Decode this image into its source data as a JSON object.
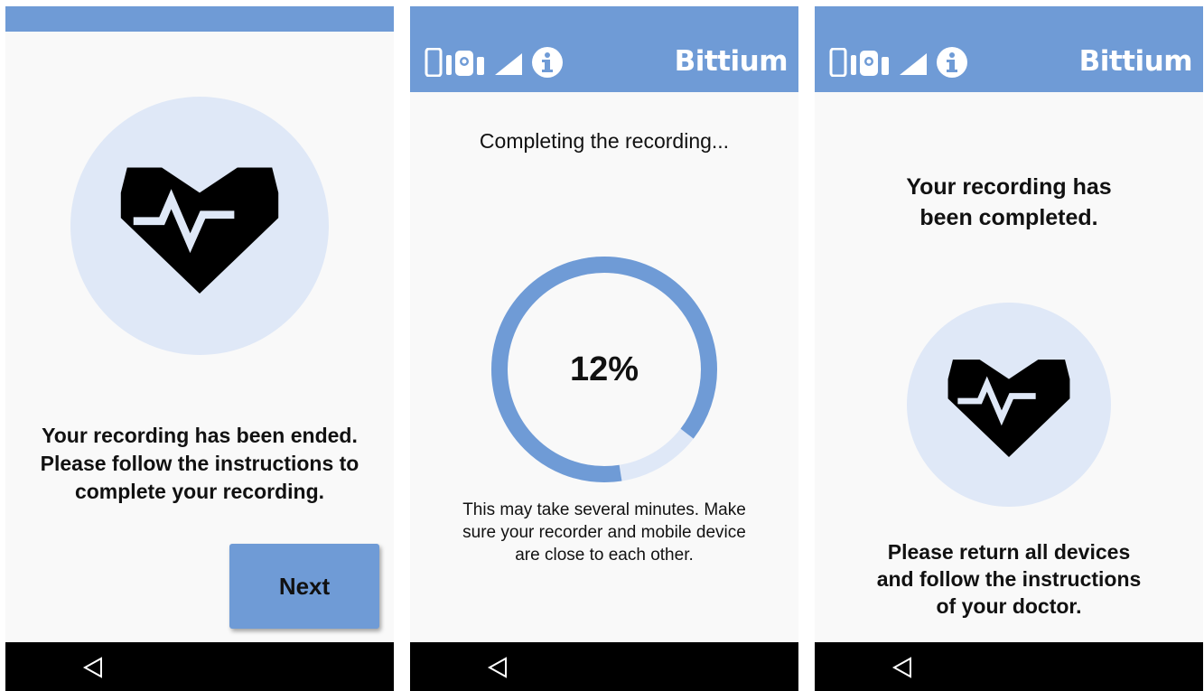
{
  "screens": [
    {
      "message": "Your recording has been ended.\nPlease follow the instructions to\ncomplete your recording.",
      "next_label": "Next"
    },
    {
      "brand": "Bittium",
      "heading": "Completing the recording...",
      "progress_text": "12%",
      "progress_fraction": 0.12,
      "info": "This may take several minutes. Make sure your recorder and mobile device are close to each other."
    },
    {
      "brand": "Bittium",
      "title": "Your recording has\nbeen completed.",
      "message": "Please return all devices\nand follow the instructions\nof your doctor."
    }
  ],
  "icons": {
    "status": [
      "phone-icon",
      "recorder-icon",
      "signal-icon",
      "info-icon"
    ],
    "heart": "heart-ecg-icon",
    "nav_back": "back-triangle-icon"
  },
  "colors": {
    "accent": "#6f9bd6",
    "accent_light": "#dfe8f7",
    "background": "#f9f9f9",
    "nav": "#000000"
  }
}
